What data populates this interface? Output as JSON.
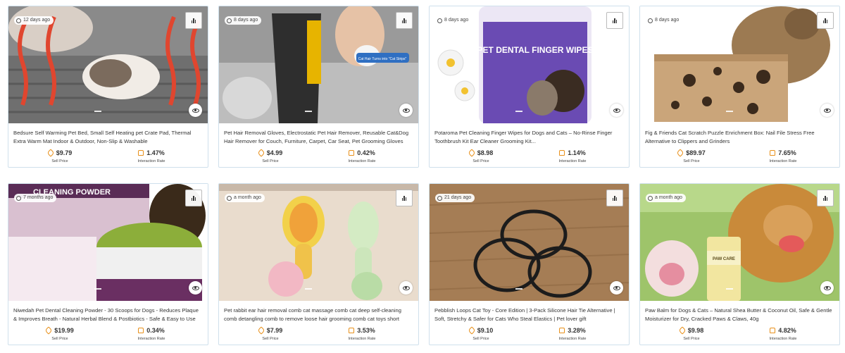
{
  "labels": {
    "sell_price": "Sell Price",
    "interaction_rate": "Interaction Rate"
  },
  "products": [
    {
      "age": "12 days ago",
      "title": "Bedsure Self Warming Pet Bed, Small Self Heating pet Crate Pad, Thermal Extra Warm Mat Indoor & Outdoor, Non-Slip & Washable",
      "price": "$9.79",
      "rate": "1.47%",
      "image": "cat-on-warming-pad-photo"
    },
    {
      "age": "8 days ago",
      "title": "Pet Hair Removal Gloves, Electrostatic Pet Hair Remover, Reusable Cat&Dog Hair Remover for Couch, Furniture, Carpet, Car Seat, Pet Grooming Gloves",
      "price": "$4.99",
      "rate": "0.42%",
      "image": "grooming-glove-photo",
      "image_text": "Cat Hair Turns into \"Cat Strips\""
    },
    {
      "age": "8 days ago",
      "title": "Potaroma Pet Cleaning Finger Wipes for Dogs and Cats – No-Rinse Finger Toothbrush Kit Ear Cleaner Grooming Kit...",
      "price": "$8.98",
      "rate": "1.14%",
      "image": "finger-wipes-jar-photo",
      "image_text": "PET DENTAL FINGER WIPES"
    },
    {
      "age": "8 days ago",
      "title": "Fig & Friends Cat Scratch Puzzle Enrichment Box: Nail File Stress Free Alternative to Clippers and Grinders",
      "price": "$89.97",
      "rate": "7.65%",
      "image": "wooden-puzzle-box-photo"
    },
    {
      "age": "7 months ago",
      "title": "Niwedah Pet Dental Cleaning Powder - 30 Scoops for Dogs - Reduces Plaque & Improves Breath - Natural Herbal Blend & Postbiotics - Safe & Easy to Use",
      "price": "$19.99",
      "rate": "0.34%",
      "image": "dental-powder-photo",
      "image_text": "CLEANING POWDER"
    },
    {
      "age": "a month ago",
      "title": "Pet rabbit ear hair removal comb cat massage comb cat deep self-cleaning comb detangling comb to remove loose hair grooming comb cat toys short stainless stee...",
      "price": "$7.99",
      "rate": "3.53%",
      "image": "rabbit-ear-combs-photo"
    },
    {
      "age": "21 days ago",
      "title": "Pebblish Loops Cat Toy - Core Edition | 3-Pack Silicone Hair Tie Alternative | Soft, Stretchy & Safer for Cats Who Steal Elastics | Pet lover gift",
      "price": "$9.10",
      "rate": "3.28%",
      "image": "silicone-loops-photo"
    },
    {
      "age": "a month ago",
      "title": "Paw Balm for Dogs & Cats – Natural Shea Butter & Coconut Oil, Safe & Gentle Moisturizer for Dry, Cracked Paws & Claws, 40g",
      "price": "$9.98",
      "rate": "4.82%",
      "image": "paw-balm-dog-photo",
      "image_text": "PAW CARE"
    }
  ]
}
